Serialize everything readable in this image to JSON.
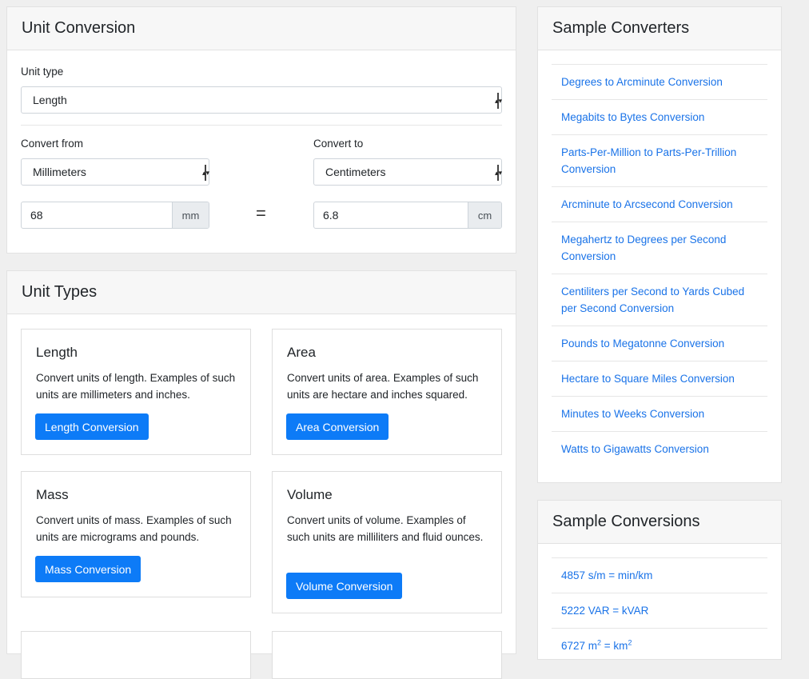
{
  "unit_conversion": {
    "title": "Unit Conversion",
    "unit_type_label": "Unit type",
    "unit_type_value": "Length",
    "convert_from_label": "Convert from",
    "convert_to_label": "Convert to",
    "from_unit": "Millimeters",
    "to_unit": "Centimeters",
    "from_value": "68",
    "from_unit_abbr": "mm",
    "equals": "=",
    "to_value": "6.8",
    "to_unit_abbr": "cm"
  },
  "unit_types": {
    "title": "Unit Types",
    "tiles": [
      {
        "title": "Length",
        "desc": "Convert units of length. Examples of such units are millimeters and inches.",
        "button": "Length Conversion"
      },
      {
        "title": "Area",
        "desc": "Convert units of area. Examples of such units are hectare and inches squared.",
        "button": "Area Conversion"
      },
      {
        "title": "Mass",
        "desc": "Convert units of mass. Examples of such units are micrograms and pounds.",
        "button": "Mass Conversion"
      },
      {
        "title": "Volume",
        "desc": "Convert units of volume. Examples of such units are milliliters and fluid ounces.",
        "button": "Volume Conversion"
      }
    ]
  },
  "sample_converters": {
    "title": "Sample Converters",
    "items": [
      "Degrees to Arcminute Conversion",
      "Megabits to Bytes Conversion",
      "Parts-Per-Million to Parts-Per-Trillion Conversion",
      "Arcminute to Arcsecond Conversion",
      "Megahertz to Degrees per Second Conversion",
      "Centiliters per Second to Yards Cubed per Second Conversion",
      "Pounds to Megatonne Conversion",
      "Hectare to Square Miles Conversion",
      "Minutes to Weeks Conversion",
      "Watts to Gigawatts Conversion"
    ]
  },
  "sample_conversions": {
    "title": "Sample Conversions",
    "items": [
      "4857 s/m = min/km",
      "5222 VAR = kVAR",
      "6727 m2 = km2"
    ]
  },
  "colors": {
    "link": "#1a73e8",
    "primary_button": "#0d7bf7",
    "background": "#efefef"
  }
}
